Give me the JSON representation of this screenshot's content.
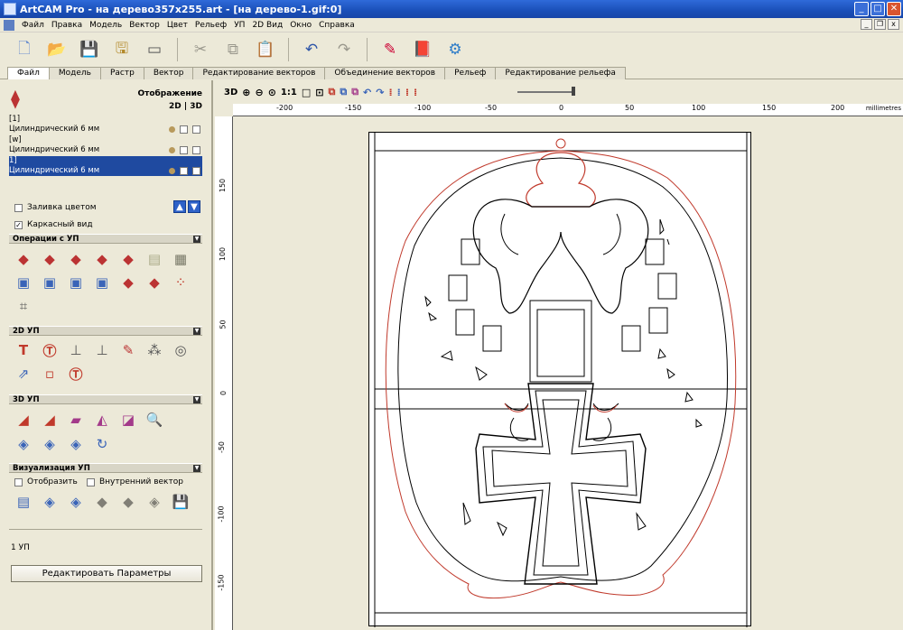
{
  "window": {
    "title": "ArtCAM Pro - на дерево357x255.art - [на дерево-1.gif:0]"
  },
  "menu": [
    "Файл",
    "Правка",
    "Модель",
    "Вектор",
    "Цвет",
    "Рельеф",
    "УП",
    "2D Вид",
    "Окно",
    "Справка"
  ],
  "tabs": [
    "Файл",
    "Модель",
    "Растр",
    "Вектор",
    "Редактирование векторов",
    "Объединение векторов",
    "Рельеф",
    "Редактирование рельефа"
  ],
  "panel": {
    "view_label": "Отображение",
    "view_toggle": "2D | 3D",
    "toolpaths": [
      {
        "group": "[1]",
        "tool": "Цилиндрический 6 мм"
      },
      {
        "group": "[w]",
        "tool": "Цилиндрический 6 мм"
      },
      {
        "group": "1]",
        "tool": "Цилиндрический 6 мм"
      }
    ],
    "fill_color_label": "Заливка цветом",
    "wireframe_label": "Каркасный вид",
    "sections": {
      "ops": "Операции с УП",
      "up2d": "2D УП",
      "up3d": "3D УП",
      "vis": "Визуализация УП"
    },
    "show_label": "Отобразить",
    "inner_vector_label": "Внутренний вектор",
    "count_text": "1 УП",
    "edit_button": "Редактировать Параметры"
  },
  "view_toolbar": {
    "mode": "3D",
    "scale": "1:1"
  },
  "ruler": {
    "units": "millimetres",
    "h_ticks": [
      "-200",
      "-150",
      "-100",
      "-50",
      "0",
      "50",
      "100",
      "150",
      "200"
    ],
    "v_ticks": [
      "150",
      "100",
      "50",
      "0",
      "-50",
      "-100",
      "-150"
    ]
  }
}
